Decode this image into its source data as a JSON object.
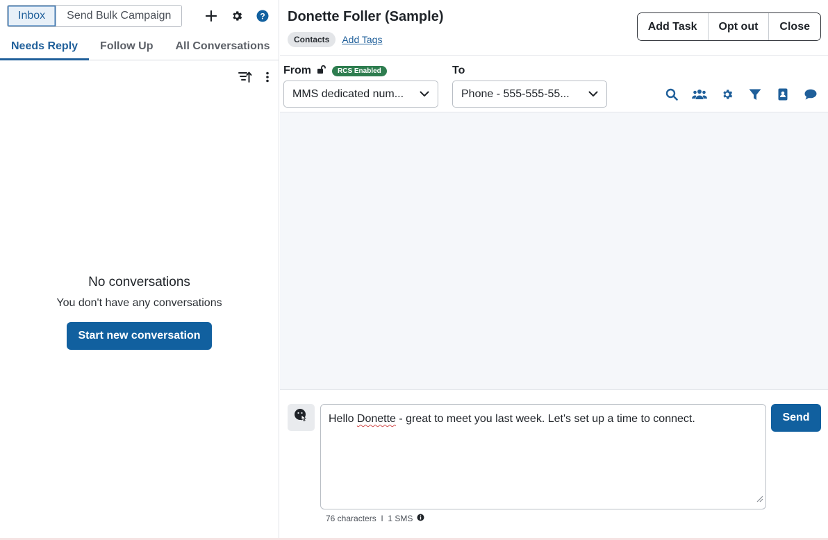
{
  "inbox": {
    "segments": [
      "Inbox",
      "Send Bulk Campaign"
    ],
    "tabs": [
      "Needs Reply",
      "Follow Up",
      "All Conversations"
    ],
    "empty_title": "No conversations",
    "empty_subtitle": "You don't have any conversations",
    "start_button": "Start new conversation"
  },
  "contact": {
    "name": "Donette Foller (Sample)",
    "chip": "Contacts",
    "add_tags": "Add Tags",
    "actions": [
      "Add Task",
      "Opt out",
      "Close"
    ]
  },
  "routing": {
    "from_label": "From",
    "rcs_badge": "RCS Enabled",
    "from_value": "MMS dedicated num...",
    "to_label": "To",
    "to_value": "Phone - 555-555-55..."
  },
  "composer": {
    "text_before": "Hello ",
    "text_misspelled": "Donette",
    "text_after": " - great to meet you last week. Let's set up a time to connect.",
    "send_label": "Send",
    "counter": "76 characters  I  1 SMS"
  },
  "colors": {
    "primary": "#11609f",
    "rcs_green": "#2e7d4f",
    "icon_blue": "#1f5f9a"
  }
}
